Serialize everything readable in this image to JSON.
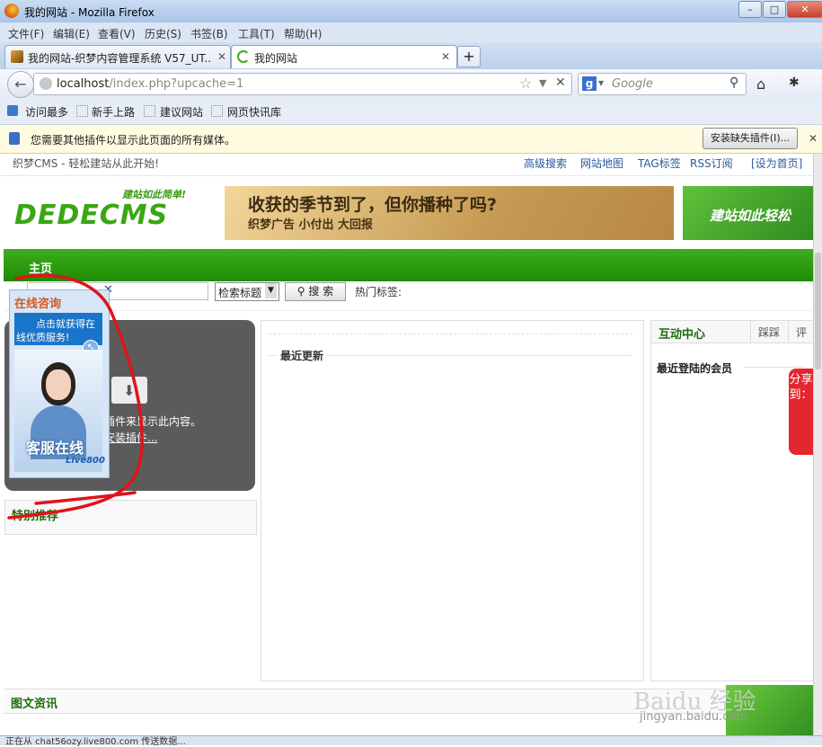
{
  "window": {
    "title": "我的网站 - Mozilla Firefox",
    "controls": [
      "–",
      "□",
      "✕"
    ]
  },
  "menubar": [
    "文件(F)",
    "编辑(E)",
    "查看(V)",
    "历史(S)",
    "书签(B)",
    "工具(T)",
    "帮助(H)"
  ],
  "tabs": [
    {
      "label": "我的网站-织梦内容管理系统 V57_UT...",
      "active": false
    },
    {
      "label": "我的网站",
      "active": true
    }
  ],
  "tab_close": "✕",
  "new_tab": "+",
  "navbar": {
    "back": "←",
    "url_host": "localhost",
    "url_path": "/index.php?upcache=1",
    "search_placeholder": "Google",
    "home": "⌂"
  },
  "bookmarks": [
    "访问最多",
    "新手上路",
    "建议网站",
    "网页快讯库"
  ],
  "plugin_notice": {
    "text": "您需要其他插件以显示此页面的所有媒体。",
    "button": "安装缺失插件(I)...",
    "close": "✕"
  },
  "page": {
    "site_tagline": "织梦CMS - 轻松建站从此开始!",
    "top_links": [
      "高级搜索",
      "网站地图",
      "TAG标签",
      "RSS订阅",
      "[设为首页]"
    ],
    "logo_slogan": "建站如此简单!",
    "logo_text": "DEDECMS",
    "banner_title": "收获的季节到了，但你播种了吗?",
    "banner_sub": "织梦广告 小付出 大回报",
    "banner2_text": "建站如此轻松",
    "nav_home": "主页",
    "search_select": "检索标题",
    "search_button": "搜 索",
    "hot_tags": "热门标签:",
    "flash_text1": "插件来显示此内容。",
    "flash_text2": "安装插件...",
    "recommend_title": "特别推荐",
    "latest_title": "最近更新",
    "interact_title": "互动中心",
    "interact_tabs": [
      "踩踩",
      "评论"
    ],
    "members_title": "最近登陆的会员",
    "share": "分享到：",
    "news_title": "图文资讯",
    "status_text": "正在从 chat56ozy.live800.com 传送数据..."
  },
  "float_widget": {
    "title": "在线咨询",
    "line1": "点击就获得在",
    "line2": "线优质服务!",
    "photo_caption": "客服在线",
    "brand": "Live800"
  },
  "watermark": "Baidu 经验",
  "watermark_url": "jingyan.baidu.com"
}
